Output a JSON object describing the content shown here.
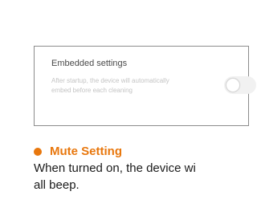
{
  "embedded_settings": {
    "title": "Embedded settings",
    "description": "After startup, the device will automatically embed before each cleaning",
    "toggle_state": "off"
  },
  "mute_setting": {
    "heading": "Mute Setting",
    "description_line1": "When turned on, the device wi",
    "description_line2": "all beep."
  },
  "colors": {
    "accent": "#e8770d",
    "card_border": "#8c8c8c",
    "muted_text": "#c4c4c4"
  }
}
